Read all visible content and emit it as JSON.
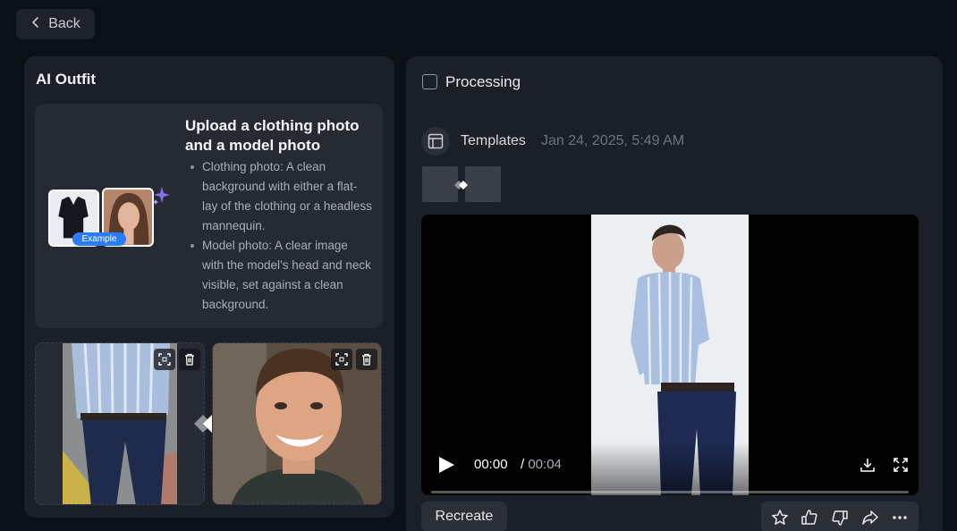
{
  "header": {
    "back_label": "Back"
  },
  "left": {
    "title": "AI Outfit",
    "info": {
      "example_badge": "Example",
      "heading": "Upload a clothing photo and a model photo",
      "bullets": [
        "Clothing photo: A clean background with either a flat-lay of the clothing or a headless mannequin.",
        "Model photo: A clear image with the model’s head and neck visible, set against a clean background."
      ]
    }
  },
  "right": {
    "processing_label": "Processing",
    "task": {
      "label": "Templates",
      "date": "Jan 24, 2025, 5:49 AM"
    },
    "video": {
      "current_time": "00:00",
      "separator": " / ",
      "duration": "00:04",
      "progress": 0.0
    },
    "recreate_label": "Recreate"
  },
  "colors": {
    "background": "#0b0f17",
    "panel": "#1b1f27",
    "card": "#252a33",
    "accent": "#2a7cf6"
  }
}
